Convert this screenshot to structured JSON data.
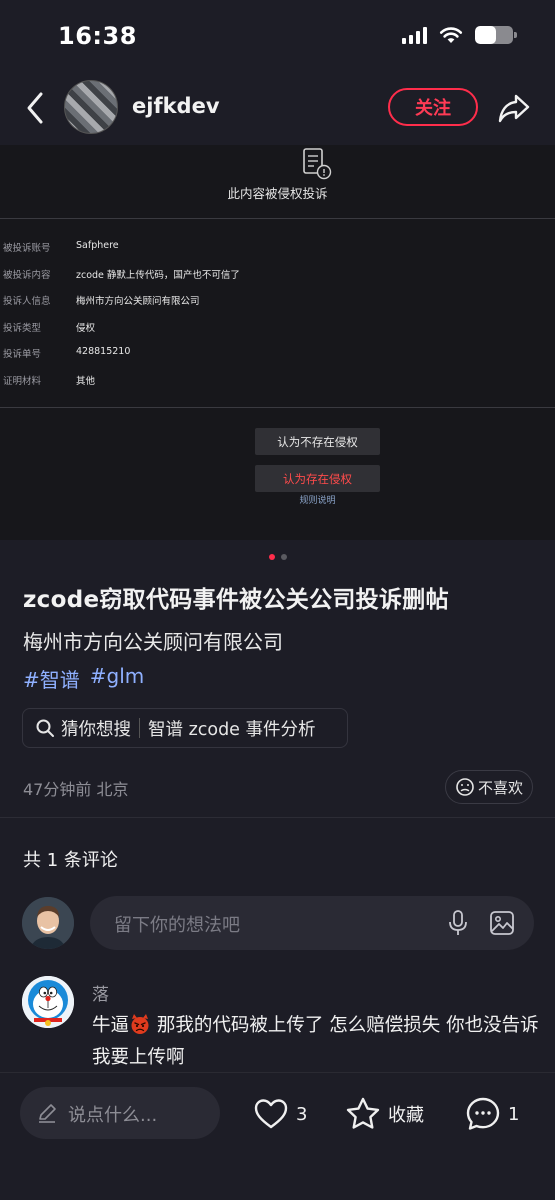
{
  "status_bar": {
    "time": "16:38"
  },
  "header": {
    "author": "ejfkdev",
    "follow_label": "关注"
  },
  "image": {
    "title": "此内容被侵权投诉",
    "rows": [
      {
        "key": "被投诉账号",
        "value": "Safphere"
      },
      {
        "key": "被投诉内容",
        "value": "zcode 静默上传代码，国产也不可信了"
      },
      {
        "key": "投诉人信息",
        "value": "梅州市方向公关顾问有限公司"
      },
      {
        "key": "投诉类型",
        "value": "侵权"
      },
      {
        "key": "投诉单号",
        "value": "428815210"
      },
      {
        "key": "证明材料",
        "value": "其他"
      }
    ],
    "btn_no": "认为不存在侵权",
    "btn_yes": "认为存在侵权",
    "rules": "规则说明"
  },
  "pagination": {
    "current": 1,
    "total": 2
  },
  "post": {
    "title": "zcode窃取代码事件被公关公司投诉删帖",
    "body": "梅州市方向公关顾问有限公司",
    "tags": [
      "#智谱",
      "#glm"
    ],
    "guess_label": "猜你想搜",
    "guess_query": "智谱 zcode 事件分析",
    "meta": "47分钟前 北京",
    "dislike_label": "不喜欢"
  },
  "comments": {
    "count_label": "共 1 条评论",
    "input_placeholder": "留下你的想法吧",
    "items": [
      {
        "name": "落",
        "text_a": "牛逼",
        "text_b": " 那我的代码被上传了 怎么赔偿损失 你也没告诉我要上传啊"
      }
    ]
  },
  "bottom_bar": {
    "placeholder": "说点什么...",
    "likes": "3",
    "collect_label": "收藏",
    "comments": "1"
  },
  "colors": {
    "accent": "#ff2d4b",
    "tag": "#8fb0ff",
    "background": "#1d1d26"
  }
}
